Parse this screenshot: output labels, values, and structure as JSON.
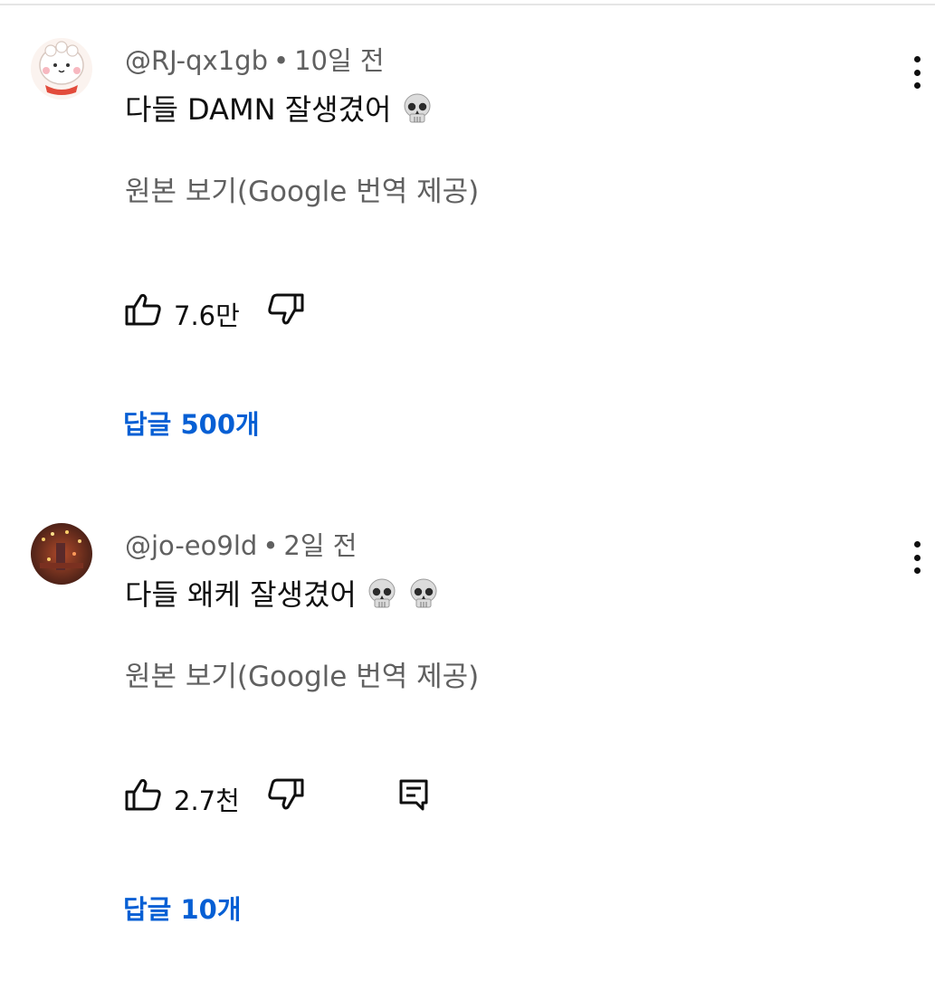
{
  "comments": [
    {
      "author": "@RJ-qx1gb",
      "time": "10일 전",
      "text": "다들 DAMN 잘생겼어",
      "emojis": [
        "skull"
      ],
      "translate": "원본 보기(Google 번역 제공)",
      "likes": "7.6만",
      "replies": "답글 500개",
      "show_reply_button": false
    },
    {
      "author": "@jo-eo9ld",
      "time": "2일 전",
      "text": "다들 왜케 잘생겼어",
      "emojis": [
        "skull",
        "skull"
      ],
      "translate": "원본 보기(Google 번역 제공)",
      "likes": "2.7천",
      "replies": "답글 10개",
      "show_reply_button": true
    }
  ],
  "separator": "•",
  "icons": [
    "thumb-up-icon",
    "thumb-down-icon",
    "reply-icon",
    "more-vert-icon",
    "skull-emoji"
  ],
  "colors": {
    "link": "#065fd4",
    "meta": "#606060",
    "text": "#0f0f0f"
  }
}
